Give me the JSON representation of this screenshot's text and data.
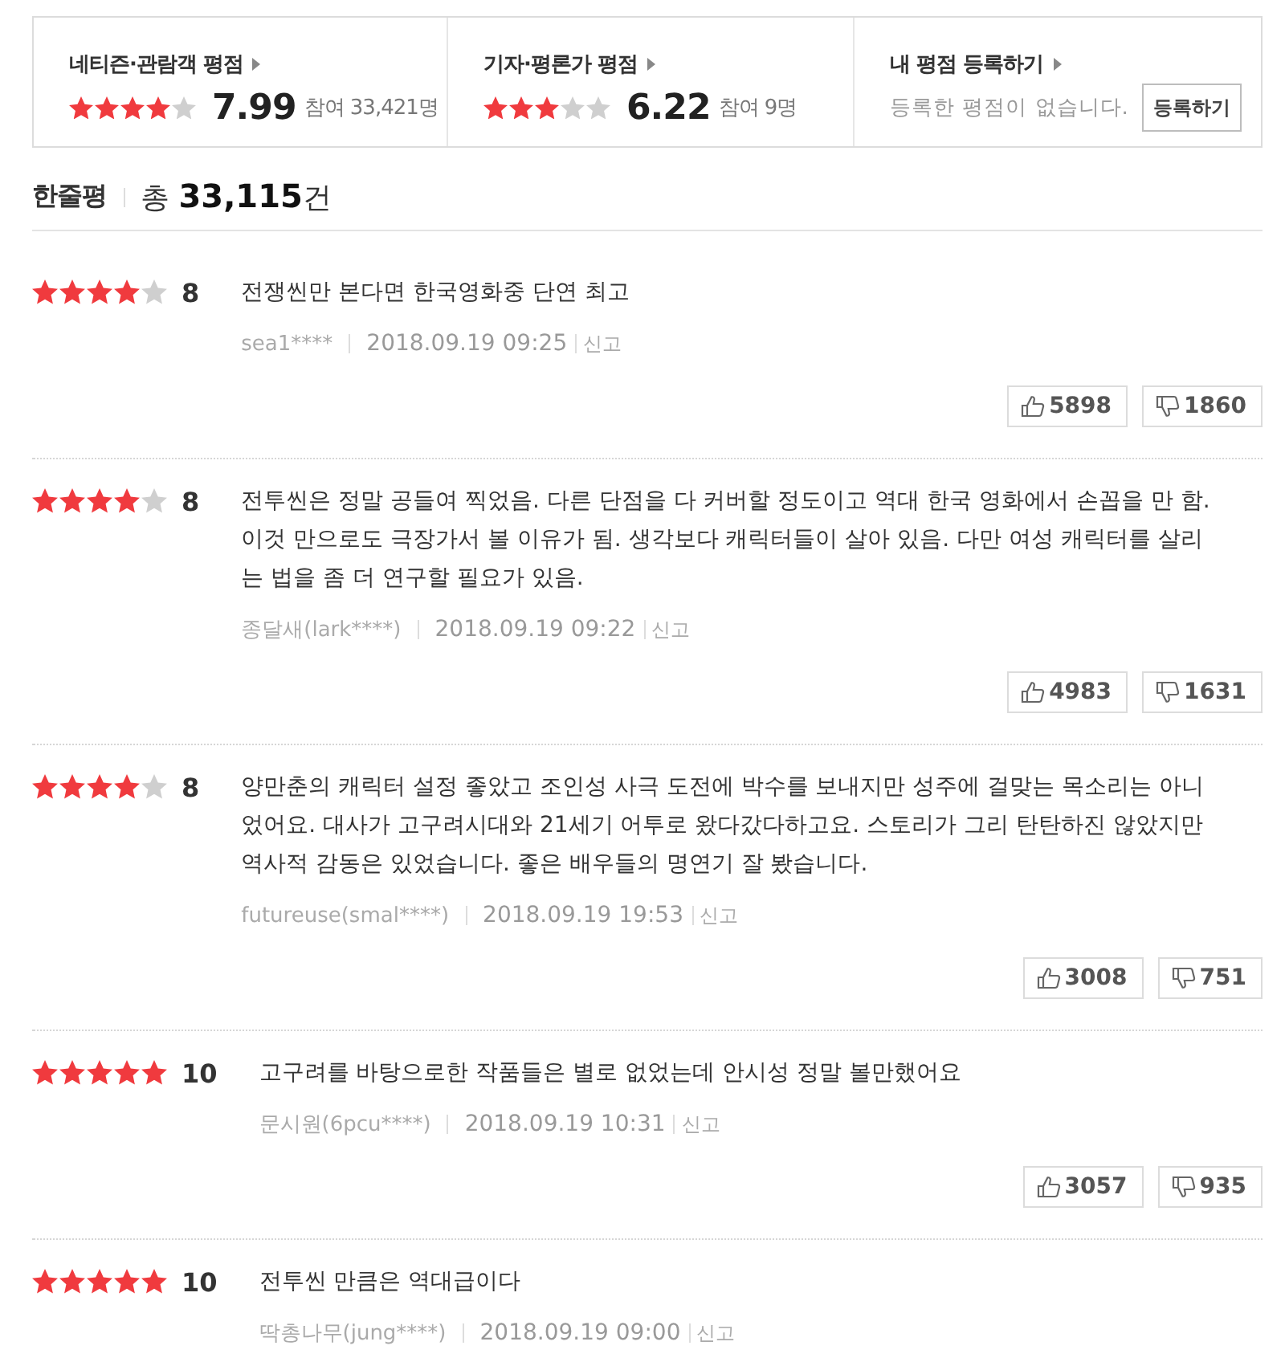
{
  "rating_summary": [
    {
      "title": "네티즌·관람객 평점",
      "stars": 4,
      "score": "7.99",
      "participants": "참여 33,421명"
    },
    {
      "title": "기자·평론가 평점",
      "stars": 3,
      "score": "6.22",
      "participants": "참여 9명"
    }
  ],
  "my_rating": {
    "title": "내 평점 등록하기",
    "message": "등록한 평점이 없습니다.",
    "button": "등록하기"
  },
  "reviews_header": {
    "title": "한줄평",
    "total": "총 **33,115**건"
  },
  "reviews": [
    {
      "stars": 4,
      "score": "8",
      "text": "전쟁씬만 본다면 한국영화중 단연 최고",
      "author": "sea1****",
      "date": "2018.09.19 09:25",
      "report": "신고",
      "likes": "5898",
      "dislikes": "1860"
    },
    {
      "stars": 4,
      "score": "8",
      "text": "전투씬은 정말 공들여 찍었음. 다른 단점을 다 커버할 정도이고 역대 한국 영화에서 손꼽을 만 함. 이것 만으로도 극장가서 볼 이유가 됨. 생각보다 캐릭터들이 살아 있음. 다만 여성 캐릭터를 살리는 법을 좀 더 연구할 필요가 있음.",
      "author": "종달새(lark****)",
      "date": "2018.09.19 09:22",
      "report": "신고",
      "likes": "4983",
      "dislikes": "1631"
    },
    {
      "stars": 4,
      "score": "8",
      "text": "양만춘의 캐릭터 설정 좋았고 조인성 사극 도전에 박수를 보내지만 성주에 걸맞는 목소리는 아니었어요. 대사가 고구려시대와 21세기 어투로 왔다갔다하고요. 스토리가 그리 탄탄하진 않았지만 역사적 감동은 있었습니다. 좋은 배우들의 명연기 잘 봤습니다.",
      "author": "futureuse(smal****)",
      "date": "2018.09.19 19:53",
      "report": "신고",
      "likes": "3008",
      "dislikes": "751"
    },
    {
      "stars": 5,
      "score": "10",
      "text": "고구려를 바탕으로한 작품들은 별로 없었는데 안시성 정말 볼만했어요",
      "author": "문시원(6pcu****)",
      "date": "2018.09.19 10:31",
      "report": "신고",
      "likes": "3057",
      "dislikes": "935"
    },
    {
      "stars": 5,
      "score": "10",
      "text": "전투씬 만큼은 역대급이다",
      "author": "딱총나무(jung****)",
      "date": "2018.09.19 09:00",
      "report": "신고"
    }
  ]
}
